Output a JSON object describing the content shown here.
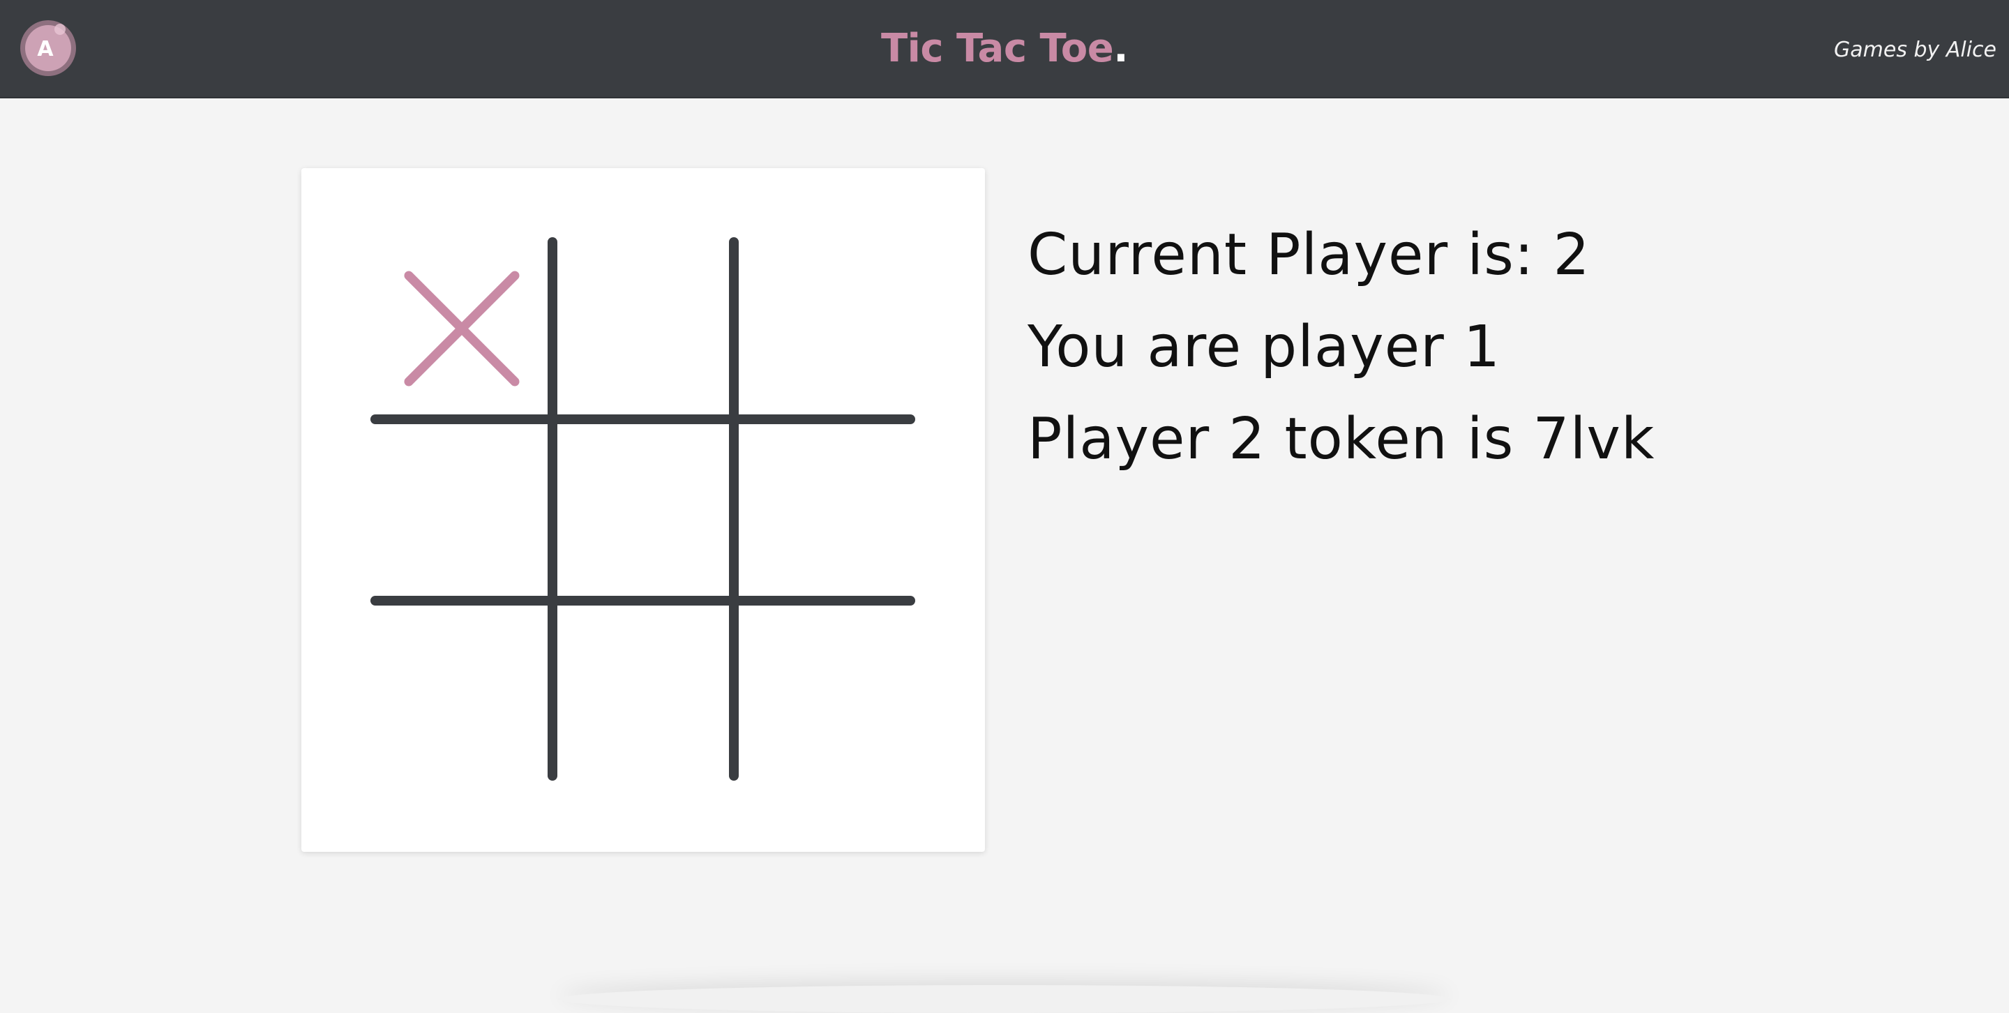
{
  "header": {
    "logo_letter": "A",
    "title": "Tic Tac Toe",
    "title_dot": ".",
    "byline": "Games by Alice"
  },
  "board": {
    "cells": [
      "X",
      "",
      "",
      "",
      "",
      "",
      "",
      "",
      ""
    ],
    "grid_color": "#3a3d41",
    "x_color": "#c98aa5"
  },
  "status": {
    "current_player": "Current Player is: 2",
    "you_are": "You are player 1",
    "opponent_token": "Player 2 token is 7lvk"
  },
  "colors": {
    "topbar": "#3a3d41",
    "accent": "#c98aa5",
    "background": "#f4f4f4"
  }
}
